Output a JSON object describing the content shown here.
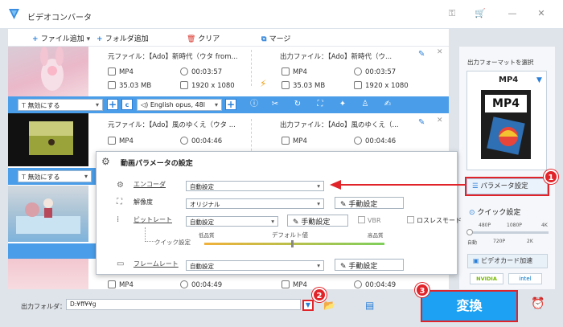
{
  "app": {
    "title": "ビデオコンバータ"
  },
  "toolbar": {
    "add_file": "ファイル追加",
    "add_folder": "フォルダ追加",
    "clear": "クリア",
    "merge": "マージ"
  },
  "rows": [
    {
      "src_file": "元ファイル：【Ado】新時代（ウタ from...",
      "out_file": "出力ファイル：【Ado】新時代（ウ...",
      "src_fmt": "MP4",
      "src_dur": "00:03:57",
      "src_size": "35.03 MB",
      "src_res": "1920 x 1080",
      "out_fmt": "MP4",
      "out_dur": "00:03:57",
      "out_size": "35.03 MB",
      "out_res": "1920 x 1080"
    },
    {
      "src_file": "元ファイル：【Ado】風のゆくえ（ウタ ...",
      "out_file": "出力ファイル：【Ado】風のゆくえ（...",
      "src_fmt": "MP4",
      "src_dur": "00:04:46",
      "out_fmt": "MP4",
      "out_dur": "00:04:46"
    },
    {
      "src_fmt": "MP4",
      "src_dur": "00:04:49",
      "out_fmt": "MP4",
      "out_dur": "00:04:49"
    }
  ],
  "subtitle_combo": "無効にする",
  "audio_combo": "English opus, 48l",
  "subtitle_combo2": "無効にする",
  "dialog": {
    "title": "動画パラメータの設定",
    "encoder_label": "エンコーダ",
    "encoder_value": "自動設定",
    "resolution_label": "解像度",
    "resolution_value": "オリジナル",
    "resolution_btn": "手動設定",
    "bitrate_label": "ビットレート",
    "bitrate_value": "自動設定",
    "bitrate_btn": "手動設定",
    "vbr": "VBR",
    "lossless": "ロスレスモード",
    "quality_label": "クイック設定",
    "low": "低品質",
    "default": "デフォルト値",
    "high": "高品質",
    "framerate_label": "フレームレート",
    "framerate_value": "自動設定",
    "framerate_btn": "手動設定"
  },
  "right": {
    "select_format": "出力フォーマットを選択",
    "format": "MP4",
    "format_icon_text": "MP4",
    "param_btn": "パラメータ設定",
    "quick_label": "クイック設定",
    "quick_ticks_top": [
      "480P",
      "1080P",
      "4K"
    ],
    "quick_ticks_bottom": [
      "自動",
      "720P",
      "2K"
    ],
    "gpu_accel": "ビデオカード加速",
    "gpu_vendors": [
      "NVIDIA",
      "intel"
    ]
  },
  "bottom": {
    "output_label": "出力フォルダ：",
    "output_path": "D:¥ff¥¥g",
    "convert": "変換"
  },
  "badges": [
    "1",
    "2",
    "3"
  ],
  "colors": {
    "accent": "#2a7fd8",
    "bar": "#4a9de8",
    "convert": "#1da1f2",
    "badge": "#e0242a"
  }
}
